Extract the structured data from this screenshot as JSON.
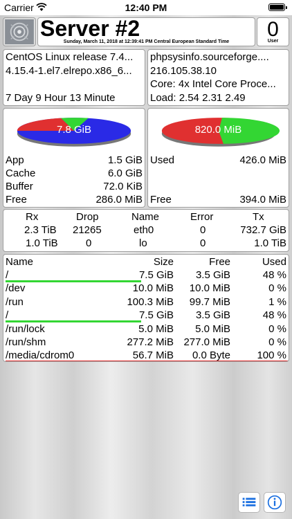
{
  "status": {
    "carrier": "Carrier",
    "time": "12:40 PM"
  },
  "header": {
    "server_name": "Server #2",
    "timestamp": "Sunday, March 11, 2018 at 12:39:41 PM Central European Standard Time",
    "users_count": "0",
    "users_label": "User"
  },
  "system": {
    "os": "CentOS Linux release 7.4...",
    "kernel": "4.15.4-1.el7.elrepo.x86_6...",
    "uptime": "7 Day 9 Hour 13 Minute",
    "hostname": "phpsysinfo.sourceforge....",
    "ip": "216.105.38.10",
    "cpu": "Core: 4x Intel Core Proce...",
    "load": "Load: 2.54 2.31 2.49"
  },
  "memory": {
    "pie_label": "7.8 GiB",
    "rows": [
      {
        "label": "App",
        "value": "1.5 GiB"
      },
      {
        "label": "Cache",
        "value": "6.0 GiB"
      },
      {
        "label": "Buffer",
        "value": "72.0 KiB"
      },
      {
        "label": "Free",
        "value": "286.0 MiB"
      }
    ],
    "colors": {
      "app": "#2a2ae6",
      "cache": "#e03030",
      "buffer": "#2a2ae6",
      "free": "#33d633"
    }
  },
  "swap": {
    "pie_label": "820.0 MiB",
    "rows": [
      {
        "label": "Used",
        "value": "426.0 MiB"
      },
      {
        "label": "Free",
        "value": "394.0 MiB"
      }
    ],
    "colors": {
      "used": "#e03030",
      "free": "#33d633"
    }
  },
  "network": {
    "headers": [
      "Rx",
      "Drop",
      "Name",
      "Error",
      "Tx"
    ],
    "rows": [
      [
        "2.3 TiB",
        "21265",
        "eth0",
        "0",
        "732.7 GiB"
      ],
      [
        "1.0 TiB",
        "0",
        "lo",
        "0",
        "1.0 TiB"
      ]
    ]
  },
  "filesystems": {
    "headers": [
      "Name",
      "Size",
      "Free",
      "Used"
    ],
    "rows": [
      {
        "name": "/",
        "size": "7.5 GiB",
        "free": "3.5 GiB",
        "used": "48 %",
        "used_pct": 48
      },
      {
        "name": "/dev",
        "size": "10.0 MiB",
        "free": "10.0 MiB",
        "used": "0 %",
        "used_pct": 0
      },
      {
        "name": "/run",
        "size": "100.3 MiB",
        "free": "99.7 MiB",
        "used": "1 %",
        "used_pct": 1
      },
      {
        "name": "/",
        "size": "7.5 GiB",
        "free": "3.5 GiB",
        "used": "48 %",
        "used_pct": 48
      },
      {
        "name": "/run/lock",
        "size": "5.0 MiB",
        "free": "5.0 MiB",
        "used": "0 %",
        "used_pct": 0
      },
      {
        "name": "/run/shm",
        "size": "277.2 MiB",
        "free": "277.0 MiB",
        "used": "0 %",
        "used_pct": 0
      },
      {
        "name": "/media/cdrom0",
        "size": "56.7 MiB",
        "free": "0.0 Byte",
        "used": "100 %",
        "used_pct": 100
      }
    ],
    "colors": {
      "normal": "#33d633",
      "full": "#e03030"
    }
  },
  "toolbar": {
    "list_icon": "list-icon",
    "info_icon": "info-icon",
    "accent": "#1a6fe0"
  }
}
